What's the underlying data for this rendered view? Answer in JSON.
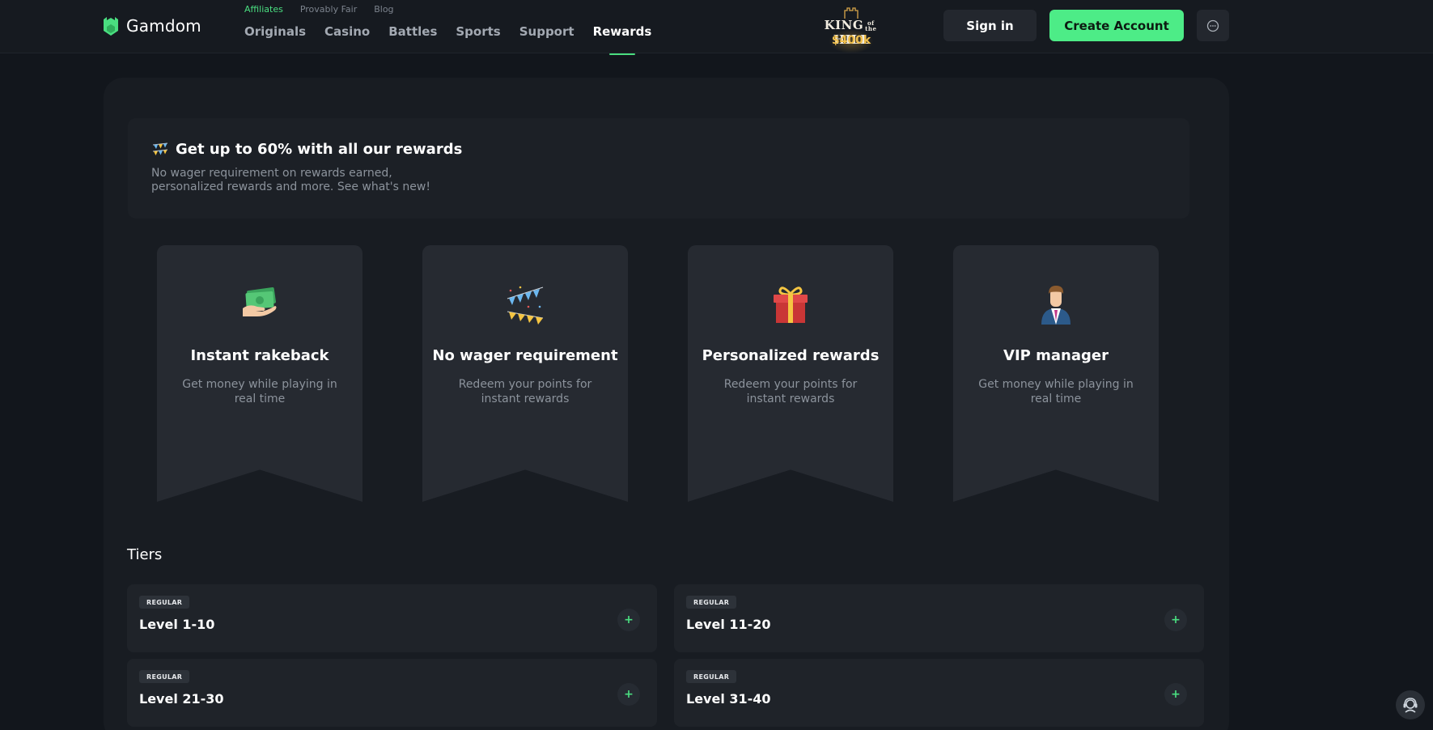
{
  "brand": {
    "name": "Gamdom",
    "accent": "#4ade80"
  },
  "subnav": [
    {
      "label": "Affiliates",
      "active": true
    },
    {
      "label": "Provably Fair",
      "active": false
    },
    {
      "label": "Blog",
      "active": false
    }
  ],
  "nav": [
    {
      "label": "Originals",
      "active": false
    },
    {
      "label": "Casino",
      "active": false
    },
    {
      "label": "Battles",
      "active": false
    },
    {
      "label": "Sports",
      "active": false
    },
    {
      "label": "Support",
      "active": false
    },
    {
      "label": "Rewards",
      "active": true
    }
  ],
  "promo": {
    "title_line1": "KING",
    "title_of": "of",
    "title_the": "the",
    "title_line2": "HILL",
    "amount": "$400k"
  },
  "auth": {
    "signin_label": "Sign in",
    "create_label": "Create Account",
    "create_color": "#4dec87"
  },
  "banner": {
    "icon": "party-icon",
    "title": "Get up to 60% with all our rewards",
    "description": "No wager requirement on rewards earned, personalized rewards and more. See what's new!"
  },
  "features": [
    {
      "icon": "cash-hand-icon",
      "title": "Instant rakeback",
      "description": "Get money while playing in real time"
    },
    {
      "icon": "bunting-icon",
      "title": "No wager requirement",
      "description": "Redeem your points for instant rewards"
    },
    {
      "icon": "gift-icon",
      "title": "Personalized rewards",
      "description": "Redeem your points for instant rewards"
    },
    {
      "icon": "vip-manager-icon",
      "title": "VIP manager",
      "description": "Get money while playing in real time"
    }
  ],
  "tiers": {
    "heading": "Tiers",
    "items": [
      {
        "badge": "REGULAR",
        "label": "Level 1-10"
      },
      {
        "badge": "REGULAR",
        "label": "Level 11-20"
      },
      {
        "badge": "REGULAR",
        "label": "Level 21-30"
      },
      {
        "badge": "REGULAR",
        "label": "Level 31-40"
      }
    ],
    "expand_symbol": "+"
  }
}
